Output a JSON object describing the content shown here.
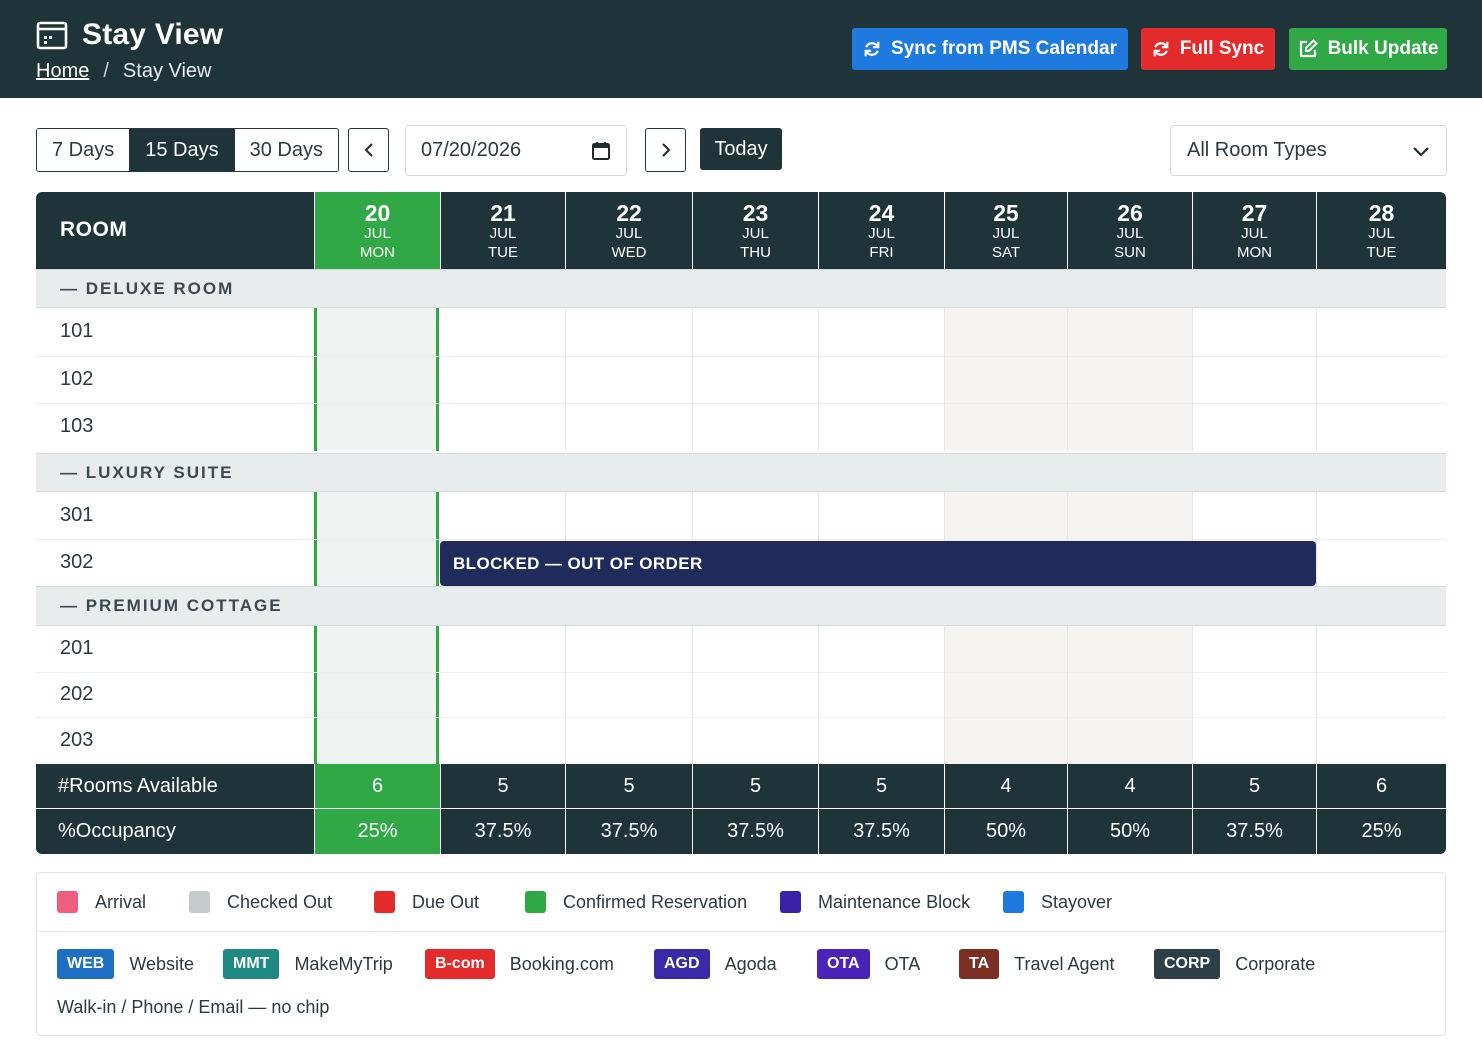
{
  "header": {
    "title": "Stay View",
    "breadcrumb": {
      "home": "Home",
      "separator": "/",
      "current": "Stay View"
    },
    "buttons": {
      "sync": "Sync from PMS Calendar",
      "full_sync": "Full Sync",
      "bulk_update": "Bulk Update"
    }
  },
  "toolbar": {
    "ranges": [
      "7 Days",
      "15 Days",
      "30 Days"
    ],
    "active_range": "15 Days",
    "date_value": "07/20/2026",
    "today_label": "Today",
    "room_type_selected": "All Room Types"
  },
  "grid": {
    "room_header": "ROOM",
    "dates": [
      {
        "day": "20",
        "month": "JUL",
        "weekday": "MON",
        "today": true
      },
      {
        "day": "21",
        "month": "JUL",
        "weekday": "TUE"
      },
      {
        "day": "22",
        "month": "JUL",
        "weekday": "WED"
      },
      {
        "day": "23",
        "month": "JUL",
        "weekday": "THU"
      },
      {
        "day": "24",
        "month": "JUL",
        "weekday": "FRI"
      },
      {
        "day": "25",
        "month": "JUL",
        "weekday": "SAT"
      },
      {
        "day": "26",
        "month": "JUL",
        "weekday": "SUN"
      },
      {
        "day": "27",
        "month": "JUL",
        "weekday": "MON"
      },
      {
        "day": "28",
        "month": "JUL",
        "weekday": "TUE"
      }
    ],
    "groups": [
      {
        "name": "DELUXE ROOM",
        "rooms": [
          "101",
          "102",
          "103"
        ]
      },
      {
        "name": "LUXURY SUITE",
        "rooms": [
          "301",
          "302"
        ]
      },
      {
        "name": "PREMIUM COTTAGE",
        "rooms": [
          "201",
          "202",
          "203"
        ]
      }
    ],
    "collapse_symbol": "—",
    "block": {
      "room": "302",
      "label": "BLOCKED — OUT OF ORDER",
      "color": "#1f2b5b"
    },
    "footer": {
      "rooms_available_label": "#Rooms Available",
      "rooms_available": [
        "6",
        "5",
        "5",
        "5",
        "5",
        "4",
        "4",
        "5",
        "6"
      ],
      "occupancy_label": "%Occupancy",
      "occupancy": [
        "25%",
        "37.5%",
        "37.5%",
        "37.5%",
        "37.5%",
        "50%",
        "50%",
        "37.5%",
        "25%"
      ]
    }
  },
  "legend": {
    "statuses": [
      {
        "label": "Arrival",
        "color": "#ee5f7f"
      },
      {
        "label": "Checked Out",
        "color": "#c3cbcb"
      },
      {
        "label": "Due Out",
        "color": "#e32b2b"
      },
      {
        "label": "Confirmed Reservation",
        "color": "#2fa845"
      },
      {
        "label": "Maintenance Block",
        "color": "#3a22a8"
      },
      {
        "label": "Stayover",
        "color": "#1f7ae0"
      }
    ],
    "channels": [
      {
        "chip": "WEB",
        "label": "Website",
        "color": "#1d6fc4"
      },
      {
        "chip": "MMT",
        "label": "MakeMyTrip",
        "color": "#1f8a84"
      },
      {
        "chip": "B-com",
        "label": "Booking.com",
        "color": "#e32b2b"
      },
      {
        "chip": "AGD",
        "label": "Agoda",
        "color": "#3b2aa8"
      },
      {
        "chip": "OTA",
        "label": "OTA",
        "color": "#4a24b8"
      },
      {
        "chip": "TA",
        "label": "Travel Agent",
        "color": "#7a2f22"
      },
      {
        "chip": "CORP",
        "label": "Corporate",
        "color": "#2c3e47"
      }
    ],
    "note": "Walk-in / Phone / Email — no chip"
  }
}
